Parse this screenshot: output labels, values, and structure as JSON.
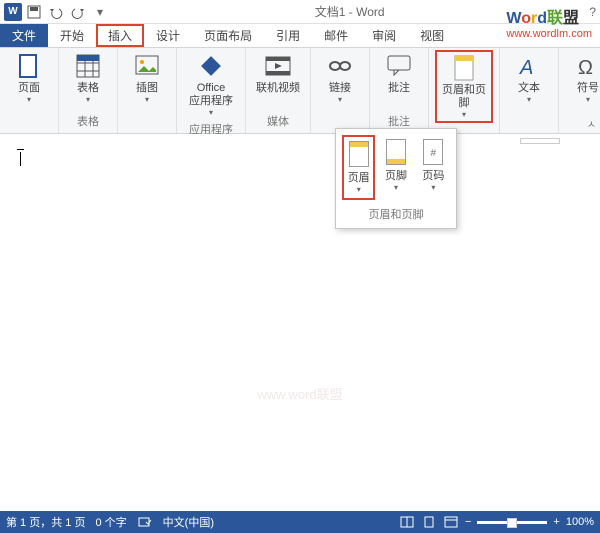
{
  "title": "文档1 - Word",
  "watermark": {
    "line1_chars": [
      "W",
      "o",
      "r",
      "d",
      "联",
      "盟"
    ],
    "line2": "www.wordlm.com"
  },
  "qat": {
    "save": "save-icon",
    "undo": "undo-icon",
    "redo": "redo-icon",
    "custom": "▾"
  },
  "tabs": [
    "文件",
    "开始",
    "插入",
    "设计",
    "页面布局",
    "引用",
    "邮件",
    "审阅",
    "视图"
  ],
  "help_hint": "?",
  "ribbon": {
    "groups": [
      {
        "label": "",
        "items": [
          {
            "name": "页面"
          }
        ]
      },
      {
        "label": "表格",
        "items": [
          {
            "name": "表格"
          }
        ]
      },
      {
        "label": "",
        "items": [
          {
            "name": "插图"
          }
        ]
      },
      {
        "label": "应用程序",
        "items": [
          {
            "name": "Office\n应用程序"
          }
        ]
      },
      {
        "label": "媒体",
        "items": [
          {
            "name": "联机视频"
          }
        ]
      },
      {
        "label": "",
        "items": [
          {
            "name": "链接"
          }
        ]
      },
      {
        "label": "批注",
        "items": [
          {
            "name": "批注"
          }
        ]
      },
      {
        "label": "",
        "items": [
          {
            "name": "页眉和页脚"
          }
        ]
      },
      {
        "label": "",
        "items": [
          {
            "name": "文本"
          }
        ]
      },
      {
        "label": "",
        "items": [
          {
            "name": "符号"
          }
        ]
      }
    ]
  },
  "dropdown": {
    "items": [
      {
        "name": "页眉"
      },
      {
        "name": "页脚"
      },
      {
        "name": "页码"
      }
    ],
    "group_label": "页眉和页脚"
  },
  "status": {
    "page": "第 1 页，共 1 页",
    "words": "0 个字",
    "lang": "中文(中国)",
    "zoom": "100%",
    "minus": "−",
    "plus": "+"
  },
  "center_wm": "www.word联盟"
}
